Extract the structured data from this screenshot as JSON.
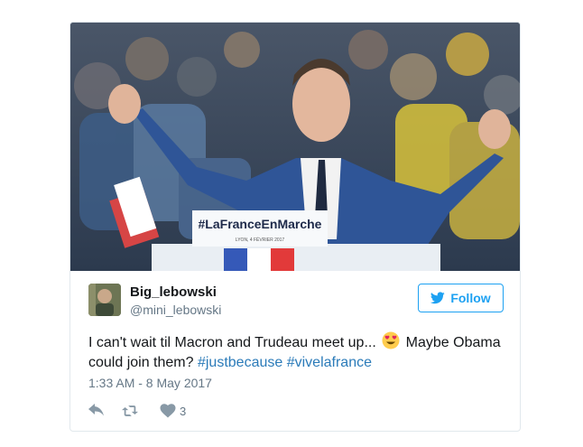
{
  "tweet": {
    "display_name": "Big_lebowski",
    "handle": "@mini_lebowski",
    "follow_label": "Follow",
    "text_before": "I can't wait til Macron and Trudeau meet up...",
    "text_middle": " Maybe Obama could join them? ",
    "hashtags": [
      "#justbecause",
      "#vivelafrance"
    ],
    "emoji": "heart-eyes",
    "timestamp": "1:33 AM - 8 May 2017",
    "like_count": "3"
  },
  "media": {
    "podium_text": "#LaFranceEnMarche",
    "podium_subtext": "LYON, 4 FÉVRIER 2017"
  },
  "icons": {
    "reply": "reply-icon",
    "retweet": "retweet-icon",
    "like": "heart-icon",
    "follow": "twitter-bird-icon"
  },
  "colors": {
    "accent": "#1da1f2",
    "hashtag": "#2b7bb9",
    "muted": "#657786",
    "text": "#14171a"
  }
}
